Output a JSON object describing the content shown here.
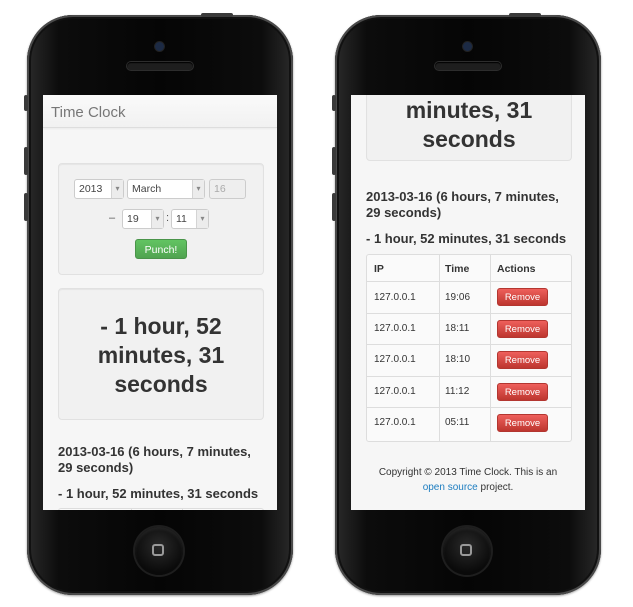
{
  "app": {
    "brand": "Time Clock"
  },
  "form": {
    "year": "2013",
    "month": "March",
    "day": "16",
    "hour": "19",
    "minute": "11",
    "dash": "–",
    "colon": ":",
    "punch_label": "Punch!"
  },
  "summary": {
    "duration_lines": [
      "- 1 hour, 52",
      "minutes, 31",
      "seconds"
    ]
  },
  "day": {
    "heading_lines": [
      "2013-03-16 (6 hours, 7 minutes,",
      "29 seconds)"
    ],
    "heading_right_lines": [
      "2013-03-16 (6 hours, 7 minutes,",
      "29 seconds)"
    ],
    "session": "- 1 hour, 52 minutes, 31 seconds"
  },
  "table": {
    "headers": [
      "IP",
      "Time",
      "Actions"
    ],
    "rows": [
      {
        "ip": "127.0.0.1",
        "time": "19:06",
        "action": "Remove"
      },
      {
        "ip": "127.0.0.1",
        "time": "18:11",
        "action": "Remove"
      },
      {
        "ip": "127.0.0.1",
        "time": "18:10",
        "action": "Remove"
      },
      {
        "ip": "127.0.0.1",
        "time": "11:12",
        "action": "Remove"
      },
      {
        "ip": "127.0.0.1",
        "time": "05:11",
        "action": "Remove"
      }
    ]
  },
  "footer": {
    "line1": "Copyright © 2013 Time Clock. This is an",
    "link": "open source",
    "line2_suffix": " project."
  },
  "icons": {
    "select_arrow": "chevron-down-icon",
    "home_button": "home-square-icon"
  },
  "colors": {
    "success": "#5bb75b",
    "danger": "#da4f49",
    "link": "#1d7dc0"
  }
}
